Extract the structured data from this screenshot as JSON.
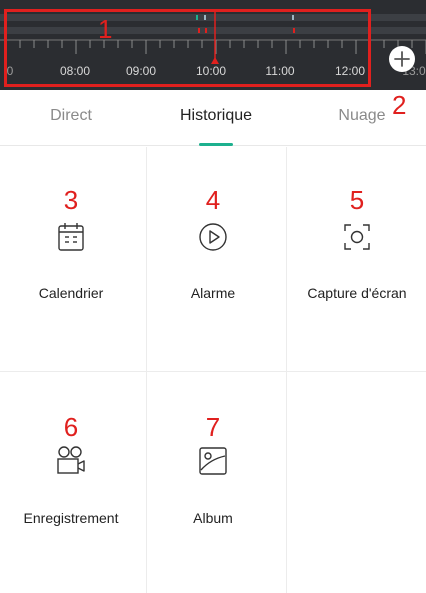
{
  "timeline": {
    "time_labels": [
      "08:00",
      "09:00",
      "10:00",
      "11:00",
      "12:00"
    ],
    "edge_labels": {
      "left": "0",
      "right": "13:0"
    },
    "playhead_time": "10:00",
    "annotation": "1",
    "add_button_icon": "plus-icon",
    "add_annotation": "2"
  },
  "tabs": {
    "items": [
      {
        "label": "Direct",
        "active": false
      },
      {
        "label": "Historique",
        "active": true
      },
      {
        "label": "Nuage",
        "active": false
      }
    ],
    "indicator_color": "#1db08e"
  },
  "tiles": [
    {
      "label": "Calendrier",
      "icon": "calendar-icon",
      "annotation": "3"
    },
    {
      "label": "Alarme",
      "icon": "play-circle-icon",
      "annotation": "4"
    },
    {
      "label": "Capture d'écran",
      "icon": "screenshot-icon",
      "annotation": "5"
    },
    {
      "label": "Enregistrement",
      "icon": "video-record-icon",
      "annotation": "6"
    },
    {
      "label": "Album",
      "icon": "album-icon",
      "annotation": "7"
    }
  ],
  "colors": {
    "annotation": "#e0201e",
    "timeline_bg": "#2b2d31",
    "accent": "#1db08e"
  }
}
